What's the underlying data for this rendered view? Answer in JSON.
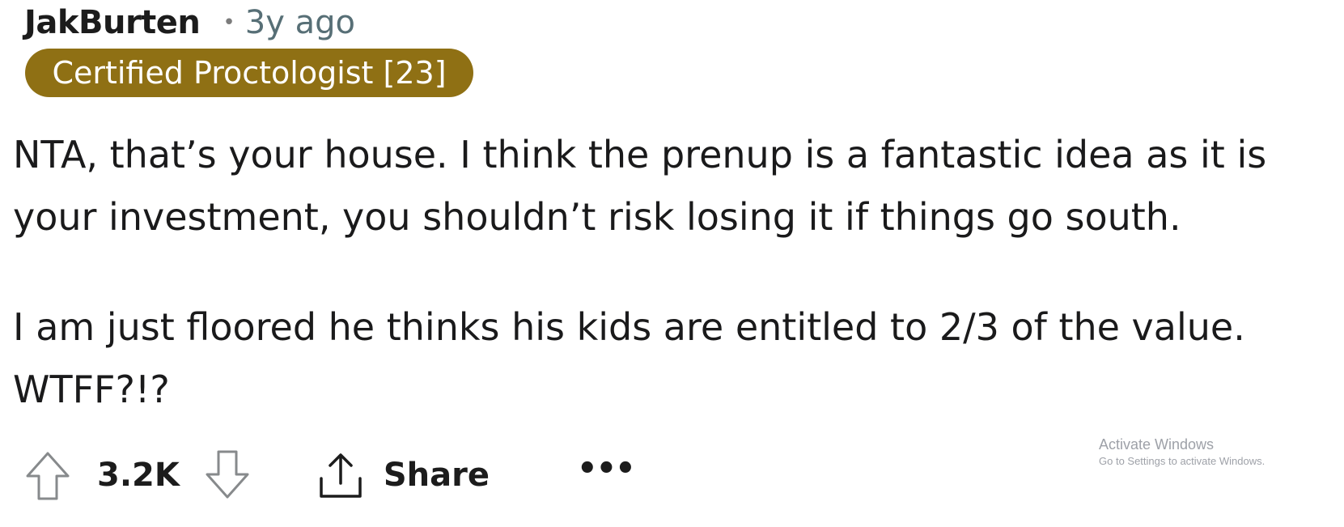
{
  "comment": {
    "author": "JakBurten",
    "separator": "•",
    "age": "3y ago",
    "flair": "Certified Proctologist [23]",
    "flair_color": "#8f7014",
    "paragraphs": [
      "NTA, that’s your house. I think the prenup is a fantastic idea as it is your investment, you shouldn’t risk losing it if things go south.",
      "I am just floored he thinks his kids are entitled to 2/3 of the value. WTFF?!?"
    ]
  },
  "actions": {
    "upvote_icon": "arrow-up-outline-icon",
    "score": "3.2K",
    "downvote_icon": "arrow-down-outline-icon",
    "share_icon": "share-upload-icon",
    "share_label": "Share",
    "more_label": "•••"
  },
  "watermark": {
    "title": "Activate Windows",
    "subtitle": "Go to Settings to activate Windows."
  }
}
